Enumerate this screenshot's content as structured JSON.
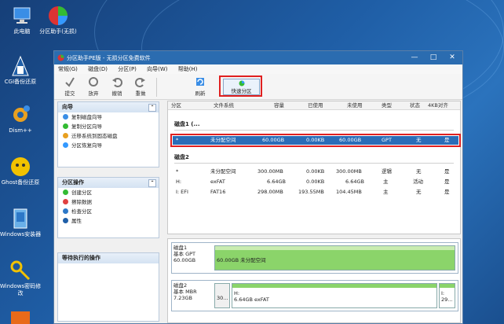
{
  "desktop": {
    "icons": [
      {
        "label": "此电脑",
        "icon": "computer-icon"
      },
      {
        "label": "分区助手(无损)",
        "icon": "partition-assistant-icon"
      },
      {
        "label": "CGI备份还原",
        "icon": "cgi-backup-icon"
      },
      {
        "label": "Dism++",
        "icon": "dism-gear-icon"
      },
      {
        "label": "Ghost备份还原",
        "icon": "ghost-icon"
      },
      {
        "label": "Windows安装器",
        "icon": "windows-installer-icon"
      },
      {
        "label": "Windows密码修改",
        "icon": "key-icon"
      }
    ]
  },
  "window": {
    "title": "分区助手PE版 - 无损分区免费软件",
    "menu": [
      "常规(G)",
      "磁盘(D)",
      "分区(P)",
      "向导(W)",
      "帮助(H)"
    ],
    "toolbar": [
      {
        "label": "提交",
        "icon": "commit-icon"
      },
      {
        "label": "放弃",
        "icon": "discard-icon"
      },
      {
        "label": "撤销",
        "icon": "undo-icon"
      },
      {
        "label": "重做",
        "icon": "redo-icon"
      },
      {
        "label": "刷新",
        "icon": "refresh-icon"
      }
    ],
    "quick_partition": "快速分区"
  },
  "left": {
    "wizard": {
      "title": "向导",
      "items": [
        "复制磁盘向导",
        "复制分区向导",
        "迁移系统到固态磁盘",
        "分区恢复向导"
      ]
    },
    "partition_ops": {
      "title": "分区操作",
      "items": [
        "创建分区",
        "擦除数据",
        "检查分区",
        "属性"
      ]
    },
    "pending": {
      "title": "等待执行的操作"
    }
  },
  "table": {
    "columns": [
      "分区",
      "文件系统",
      "容量",
      "已使用",
      "未使用",
      "类型",
      "状态",
      "4KB对齐"
    ],
    "disk1_label": "磁盘1 (...",
    "disk1_row": [
      "*",
      "未分配空间",
      "60.00GB",
      "0.00KB",
      "60.00GB",
      "GPT",
      "无",
      "是"
    ],
    "disk2_label": "磁盘2",
    "disk2_rows": [
      [
        "*",
        "未分配空间",
        "300.00MB",
        "0.00KB",
        "300.00MB",
        "逻辑",
        "无",
        "是"
      ],
      [
        "H:",
        "exFAT",
        "6.64GB",
        "0.00KB",
        "6.64GB",
        "主",
        "活动",
        "是"
      ],
      [
        "I: EFI",
        "FAT16",
        "298.00MB",
        "193.55MB",
        "104.45MB",
        "主",
        "无",
        "是"
      ]
    ]
  },
  "visual": {
    "disk1": {
      "name": "磁盘1",
      "type": "基本 GPT",
      "size": "60.00GB",
      "part_label": "60.00GB 未分配空间"
    },
    "disk2": {
      "name": "磁盘2",
      "type": "基本 MBR",
      "size": "7.23GB",
      "p1": "30...",
      "p2_name": "H:",
      "p2_desc": "6.64GB exFAT",
      "p3_name": "I:",
      "p3_desc": "29..."
    }
  },
  "colors": {
    "selection": "#2a6db8",
    "unallocated": "#8bd46a",
    "highlight": "#e02020",
    "titlebar": "#2b6cb0"
  }
}
